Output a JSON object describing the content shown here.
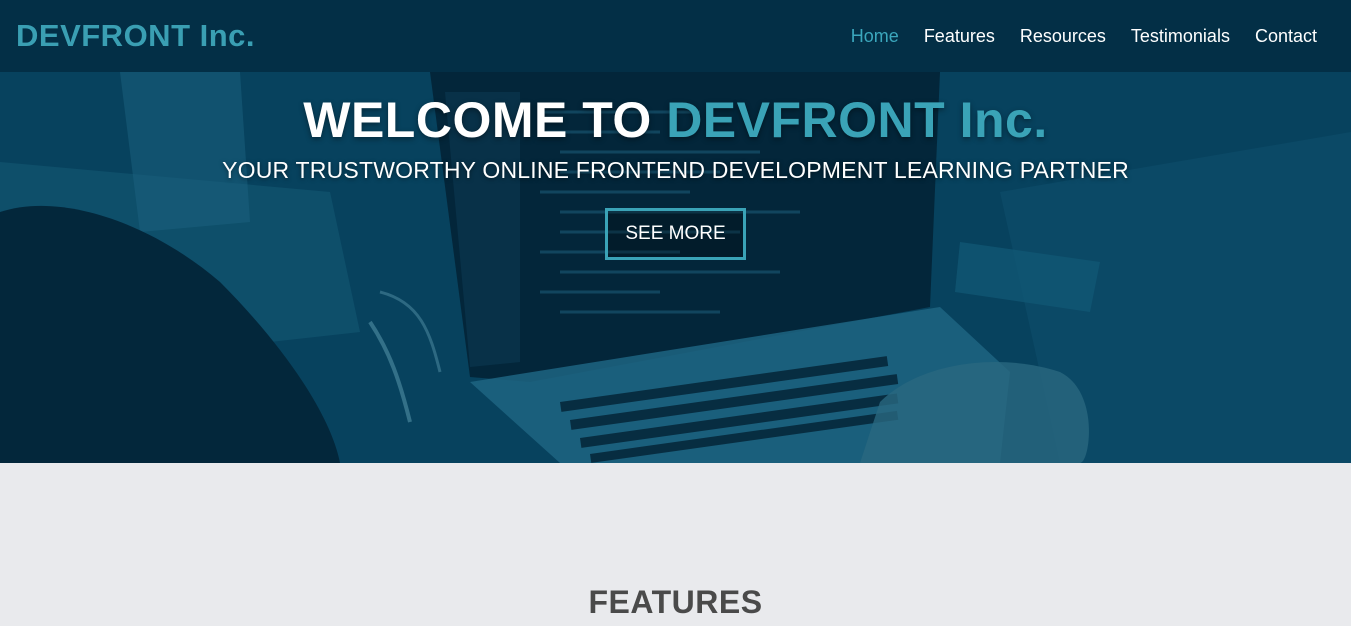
{
  "navbar": {
    "brand": "DEVFRONT Inc.",
    "links": [
      {
        "label": "Home",
        "active": true
      },
      {
        "label": "Features",
        "active": false
      },
      {
        "label": "Resources",
        "active": false
      },
      {
        "label": "Testimonials",
        "active": false
      },
      {
        "label": "Contact",
        "active": false
      }
    ]
  },
  "hero": {
    "title_prefix": "WELCOME TO",
    "title_accent": "DEVFRONT Inc.",
    "subtitle": "YOUR TRUSTWORTHY ONLINE FRONTEND DEVELOPMENT LEARNING PARTNER",
    "cta_label": "SEE MORE"
  },
  "features": {
    "title": "FEATURES"
  },
  "colors": {
    "navbar_bg": "#032f46",
    "accent": "#3aa3b7",
    "section_bg": "#e9eaed",
    "heading_gray": "#4a4a4a"
  }
}
